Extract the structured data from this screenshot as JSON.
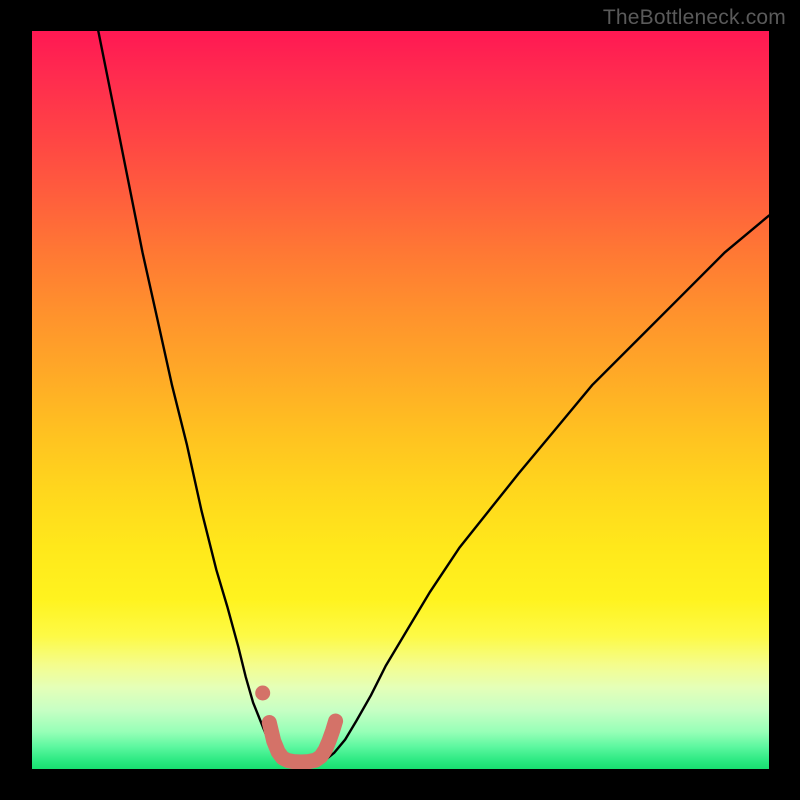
{
  "watermark": "TheBottleneck.com",
  "colors": {
    "frame": "#000000",
    "curve": "#000000",
    "marker": "#d47268",
    "marker_dot": "#d47268"
  },
  "chart_data": {
    "type": "line",
    "title": "",
    "xlabel": "",
    "ylabel": "",
    "xlim": [
      0,
      100
    ],
    "ylim": [
      0,
      100
    ],
    "series": [
      {
        "name": "left-curve",
        "x": [
          9,
          11,
          13,
          15,
          17,
          19,
          21,
          23,
          25,
          26.5,
          28,
          29,
          30,
          31,
          31.7,
          32.3,
          33,
          33.5,
          34
        ],
        "y": [
          100,
          90,
          80,
          70,
          61,
          52,
          44,
          35,
          27,
          22,
          16.5,
          12.5,
          9,
          6.5,
          4.8,
          3.4,
          2.3,
          1.6,
          1.4
        ]
      },
      {
        "name": "right-curve",
        "x": [
          40,
          41,
          42.5,
          44,
          46,
          48,
          51,
          54,
          58,
          62,
          66,
          71,
          76,
          82,
          88,
          94,
          100
        ],
        "y": [
          1.4,
          2.2,
          4,
          6.5,
          10,
          14,
          19,
          24,
          30,
          35,
          40,
          46,
          52,
          58,
          64,
          70,
          75
        ]
      },
      {
        "name": "valley-marker-band",
        "x": [
          32.2,
          32.8,
          33.4,
          34,
          34.7,
          35.5,
          36.5,
          37.5,
          38.5,
          39.2,
          39.8,
          40.3,
          40.8,
          41.2
        ],
        "y": [
          6.3,
          3.8,
          2.3,
          1.5,
          1.15,
          1.0,
          0.95,
          1.0,
          1.2,
          1.7,
          2.6,
          3.8,
          5.2,
          6.5
        ]
      }
    ],
    "markers": [
      {
        "name": "left-dot",
        "x": 31.3,
        "y": 10.3
      }
    ],
    "notes": "No numeric axis ticks or labels are rendered; values above are estimated on a 0–100 normalized scale inferred from the plot box."
  }
}
